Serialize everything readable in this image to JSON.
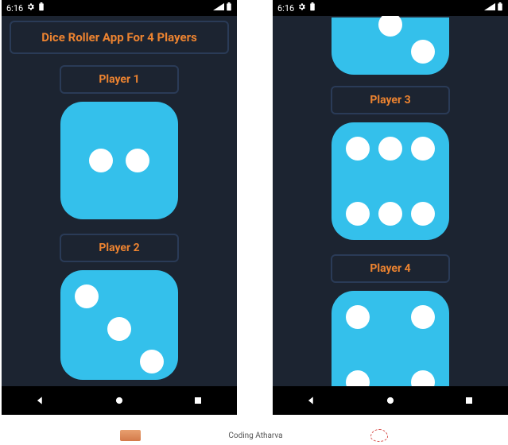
{
  "status": {
    "time": "6:16",
    "icons_left": [
      "gear-icon",
      "battery-icon"
    ],
    "icons_right": [
      "signal-icon",
      "battery-full-icon"
    ]
  },
  "app": {
    "title": "Dice Roller App For 4 Players"
  },
  "left_screen": {
    "players": [
      {
        "label": "Player 1",
        "die_value": 2
      },
      {
        "label": "Player 2",
        "die_value": 3
      }
    ]
  },
  "right_screen": {
    "top_partial_die_value": 2,
    "players": [
      {
        "label": "Player 3",
        "die_value": 6
      },
      {
        "label": "Player 4",
        "die_value": 4
      }
    ]
  },
  "nav": {
    "buttons": [
      "back",
      "home",
      "recent"
    ]
  },
  "footer": {
    "caption": "Coding Atharva"
  }
}
